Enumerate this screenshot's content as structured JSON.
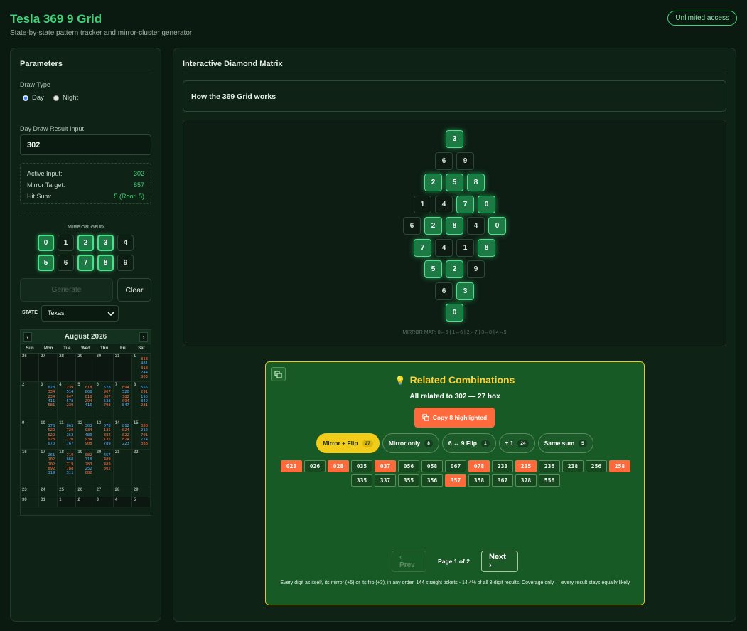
{
  "header": {
    "title": "Tesla 369 9 Grid",
    "subtitle": "State-by-state pattern tracker and mirror-cluster generator",
    "badge": "Unlimited access"
  },
  "params": {
    "heading": "Parameters",
    "draw_type_label": "Draw Type",
    "day_label": "Day",
    "night_label": "Night",
    "result_label": "Day Draw Result Input",
    "result_value": "302",
    "active_input_label": "Active Input:",
    "active_input_value": "302",
    "mirror_target_label": "Mirror Target:",
    "mirror_target_value": "857",
    "hit_sum_label": "Hit Sum:",
    "hit_sum_value": "5 (Root: 5)",
    "mirror_grid_label": "MIRROR GRID",
    "mirror_grid": [
      {
        "d": "0",
        "on": true
      },
      {
        "d": "1",
        "on": false
      },
      {
        "d": "2",
        "on": true
      },
      {
        "d": "3",
        "on": true
      },
      {
        "d": "4",
        "on": false
      },
      {
        "d": "5",
        "on": true
      },
      {
        "d": "6",
        "on": false
      },
      {
        "d": "7",
        "on": true
      },
      {
        "d": "8",
        "on": true
      },
      {
        "d": "9",
        "on": false
      }
    ],
    "generate_label": "Generate",
    "clear_label": "Clear",
    "state_label": "STATE",
    "state_value": "Texas"
  },
  "calendar": {
    "month": "August 2026",
    "prev": "‹",
    "next": "›",
    "dows": [
      "Sun",
      "Mon",
      "Tue",
      "Wed",
      "Thu",
      "Fri",
      "Sat"
    ],
    "weeks": [
      [
        {
          "d": "26",
          "dim": true,
          "n": []
        },
        {
          "d": "27",
          "dim": true,
          "n": []
        },
        {
          "d": "28",
          "dim": true,
          "n": []
        },
        {
          "d": "29",
          "dim": true,
          "n": []
        },
        {
          "d": "30",
          "dim": true,
          "n": []
        },
        {
          "d": "31",
          "dim": true,
          "n": []
        },
        {
          "d": "1",
          "dim": false,
          "n": [
            [
              "818",
              "h1"
            ],
            [
              "481",
              "h2"
            ],
            [
              "818",
              "h1"
            ],
            [
              "244",
              "h2"
            ],
            [
              "803",
              "h1"
            ]
          ]
        }
      ],
      [
        {
          "d": "2",
          "dim": false,
          "n": []
        },
        {
          "d": "3",
          "dim": false,
          "n": [
            [
              "628",
              "h2"
            ],
            [
              "334",
              "h1"
            ],
            [
              "234",
              "h1"
            ],
            [
              "411",
              "h2"
            ],
            [
              "581",
              "h1"
            ]
          ]
        },
        {
          "d": "4",
          "dim": false,
          "n": [
            [
              "239",
              "h1"
            ],
            [
              "514",
              "h2"
            ],
            [
              "047",
              "h1"
            ],
            [
              "578",
              "h2"
            ],
            [
              "239",
              "h1"
            ]
          ]
        },
        {
          "d": "5",
          "dim": false,
          "n": [
            [
              "018",
              "h1"
            ],
            [
              "808",
              "h2"
            ],
            [
              "018",
              "h1"
            ],
            [
              "294",
              "h1"
            ],
            [
              "416",
              "h2"
            ]
          ]
        },
        {
          "d": "6",
          "dim": false,
          "n": [
            [
              "578",
              "h2"
            ],
            [
              "907",
              "h1"
            ],
            [
              "807",
              "h1"
            ],
            [
              "538",
              "h2"
            ],
            [
              "798",
              "h1"
            ]
          ]
        },
        {
          "d": "7",
          "dim": false,
          "n": [
            [
              "094",
              "h1"
            ],
            [
              "520",
              "h2"
            ],
            [
              "382",
              "h1"
            ],
            [
              "094",
              "h1"
            ],
            [
              "847",
              "h2"
            ]
          ]
        },
        {
          "d": "8",
          "dim": false,
          "n": [
            [
              "655",
              "h2"
            ],
            [
              "291",
              "h1"
            ],
            [
              "195",
              "h2"
            ],
            [
              "849",
              "h2"
            ],
            [
              "281",
              "h1"
            ]
          ]
        }
      ],
      [
        {
          "d": "9",
          "dim": false,
          "n": []
        },
        {
          "d": "10",
          "dim": false,
          "n": [
            [
              "178",
              "h2"
            ],
            [
              "522",
              "h1"
            ],
            [
              "522",
              "h1"
            ],
            [
              "028",
              "h1"
            ],
            [
              "670",
              "h2"
            ]
          ]
        },
        {
          "d": "11",
          "dim": false,
          "n": [
            [
              "863",
              "h2"
            ],
            [
              "720",
              "h1"
            ],
            [
              "263",
              "h2"
            ],
            [
              "720",
              "h1"
            ],
            [
              "767",
              "h2"
            ]
          ]
        },
        {
          "d": "12",
          "dim": false,
          "n": [
            [
              "303",
              "h2"
            ],
            [
              "934",
              "h1"
            ],
            [
              "480",
              "h2"
            ],
            [
              "934",
              "h1"
            ],
            [
              "908",
              "h1"
            ]
          ]
        },
        {
          "d": "13",
          "dim": false,
          "n": [
            [
              "078",
              "h2"
            ],
            [
              "135",
              "h1"
            ],
            [
              "882",
              "h1"
            ],
            [
              "135",
              "h1"
            ],
            [
              "789",
              "h2"
            ]
          ]
        },
        {
          "d": "14",
          "dim": false,
          "n": [
            [
              "812",
              "h2"
            ],
            [
              "824",
              "h1"
            ],
            [
              "822",
              "h1"
            ],
            [
              "824",
              "h1"
            ],
            [
              "223",
              "h2"
            ]
          ]
        },
        {
          "d": "15",
          "dim": false,
          "n": [
            [
              "388",
              "h1"
            ],
            [
              "212",
              "h2"
            ],
            [
              "701",
              "h1"
            ],
            [
              "714",
              "h2"
            ],
            [
              "388",
              "h1"
            ]
          ]
        }
      ],
      [
        {
          "d": "16",
          "dim": false,
          "n": []
        },
        {
          "d": "17",
          "dim": false,
          "n": [
            [
              "261",
              "h2"
            ],
            [
              "102",
              "h1"
            ],
            [
              "102",
              "h1"
            ],
            [
              "892",
              "h1"
            ],
            [
              "319",
              "h2"
            ]
          ]
        },
        {
          "d": "18",
          "dim": false,
          "n": [
            [
              "719",
              "h1"
            ],
            [
              "868",
              "h2"
            ],
            [
              "719",
              "h1"
            ],
            [
              "788",
              "h1"
            ],
            [
              "311",
              "h2"
            ]
          ]
        },
        {
          "d": "19",
          "dim": false,
          "n": [
            [
              "082",
              "h1"
            ],
            [
              "718",
              "h2"
            ],
            [
              "283",
              "h1"
            ],
            [
              "252",
              "h2"
            ],
            [
              "082",
              "h1"
            ]
          ]
        },
        {
          "d": "20",
          "dim": false,
          "n": [
            [
              "457",
              "h2"
            ],
            [
              "489",
              "h1"
            ],
            [
              "489",
              "h1"
            ],
            [
              "302",
              "h1"
            ]
          ]
        },
        {
          "d": "21",
          "dim": false,
          "n": []
        },
        {
          "d": "22",
          "dim": false,
          "n": []
        }
      ],
      [
        {
          "d": "23",
          "dim": false,
          "n": []
        },
        {
          "d": "24",
          "dim": false,
          "n": []
        },
        {
          "d": "25",
          "dim": false,
          "n": []
        },
        {
          "d": "26",
          "dim": false,
          "n": []
        },
        {
          "d": "27",
          "dim": false,
          "n": []
        },
        {
          "d": "28",
          "dim": false,
          "n": []
        },
        {
          "d": "29",
          "dim": false,
          "n": []
        }
      ],
      [
        {
          "d": "30",
          "dim": false,
          "n": []
        },
        {
          "d": "31",
          "dim": false,
          "n": []
        },
        {
          "d": "1",
          "dim": true,
          "n": []
        },
        {
          "d": "2",
          "dim": true,
          "n": []
        },
        {
          "d": "3",
          "dim": true,
          "n": []
        },
        {
          "d": "4",
          "dim": true,
          "n": []
        },
        {
          "d": "5",
          "dim": true,
          "n": []
        }
      ]
    ]
  },
  "matrix": {
    "heading": "Interactive Diamond Matrix",
    "how_label": "How the 369 Grid works",
    "rows": [
      [
        {
          "d": "3",
          "on": true
        }
      ],
      [
        {
          "d": "6",
          "on": false
        },
        {
          "d": "9",
          "on": false
        }
      ],
      [
        {
          "d": "2",
          "on": true
        },
        {
          "d": "5",
          "on": true
        },
        {
          "d": "8",
          "on": true
        }
      ],
      [
        {
          "d": "1",
          "on": false
        },
        {
          "d": "4",
          "on": false
        },
        {
          "d": "7",
          "on": true
        },
        {
          "d": "0",
          "on": true
        }
      ],
      [
        {
          "d": "6",
          "on": false
        },
        {
          "d": "2",
          "on": true
        },
        {
          "d": "8",
          "on": true
        },
        {
          "d": "4",
          "on": false
        },
        {
          "d": "0",
          "on": true
        }
      ],
      [
        {
          "d": "7",
          "on": true
        },
        {
          "d": "4",
          "on": false
        },
        {
          "d": "1",
          "on": false
        },
        {
          "d": "8",
          "on": true
        }
      ],
      [
        {
          "d": "5",
          "on": true
        },
        {
          "d": "2",
          "on": true
        },
        {
          "d": "9",
          "on": false
        }
      ],
      [
        {
          "d": "6",
          "on": false
        },
        {
          "d": "3",
          "on": true
        }
      ],
      [
        {
          "d": "0",
          "on": true
        }
      ]
    ],
    "mirror_map": "MIRROR MAP: 0↔5 | 1↔6 | 2↔7 | 3↔8 | 4↔9"
  },
  "related": {
    "icon": "💡",
    "title": "Related Combinations",
    "subtitle": "All related to 302 — 27 box",
    "copy_label": "Copy 8 highlighted",
    "filters": [
      {
        "label": "Mirror + Flip",
        "count": "27",
        "on": true
      },
      {
        "label": "Mirror only",
        "count": "8",
        "on": false
      },
      {
        "label": "6 ↔ 9 Flip",
        "count": "1",
        "on": false
      },
      {
        "label": "± 1",
        "count": "24",
        "on": false
      },
      {
        "label": "Same sum",
        "count": "5",
        "on": false
      }
    ],
    "combos": [
      {
        "v": "023",
        "hl": true
      },
      {
        "v": "026",
        "hl": false
      },
      {
        "v": "028",
        "hl": true
      },
      {
        "v": "035",
        "hl": false
      },
      {
        "v": "037",
        "hl": true
      },
      {
        "v": "056",
        "hl": false
      },
      {
        "v": "058",
        "hl": false
      },
      {
        "v": "067",
        "hl": false
      },
      {
        "v": "078",
        "hl": true
      },
      {
        "v": "233",
        "hl": false
      },
      {
        "v": "235",
        "hl": true
      },
      {
        "v": "236",
        "hl": false
      },
      {
        "v": "238",
        "hl": false
      },
      {
        "v": "256",
        "hl": false
      },
      {
        "v": "258",
        "hl": true
      },
      {
        "v": "335",
        "hl": false
      },
      {
        "v": "337",
        "hl": false
      },
      {
        "v": "355",
        "hl": false
      },
      {
        "v": "356",
        "hl": false
      },
      {
        "v": "357",
        "hl": true
      },
      {
        "v": "358",
        "hl": false
      },
      {
        "v": "367",
        "hl": false
      },
      {
        "v": "378",
        "hl": false
      },
      {
        "v": "556",
        "hl": false
      }
    ],
    "prev_label": "‹ Prev",
    "page_label": "Page 1 of 2",
    "next_label": "Next ›",
    "footer": "Every digit as itself, its mirror (+5) or its flip (+3), in any order. 144 straight tickets - 14.4% of all 3-digit results. Coverage only — every result stays equally likely."
  },
  "colors": {
    "accent": "#41d27a",
    "highlight": "#ff6a3d",
    "gold": "#f1cc18",
    "blue": "#5ba8ff"
  },
  "icons": {
    "copy": "copy-icon",
    "bulb": "lightbulb-icon",
    "chevron": "chevron-down-icon"
  }
}
